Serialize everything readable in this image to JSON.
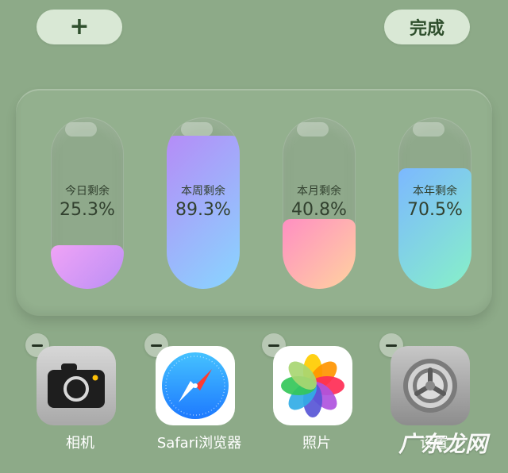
{
  "controls": {
    "add_label": "+",
    "done_label": "完成"
  },
  "widget": {
    "meters": [
      {
        "label": "今日剩余",
        "value": "25.3%",
        "fraction": 0.253
      },
      {
        "label": "本周剩余",
        "value": "89.3%",
        "fraction": 0.893
      },
      {
        "label": "本月剩余",
        "value": "40.8%",
        "fraction": 0.408
      },
      {
        "label": "本年剩余",
        "value": "70.5%",
        "fraction": 0.705
      }
    ]
  },
  "apps": [
    {
      "name": "相机",
      "icon": "camera-icon"
    },
    {
      "name": "Safari浏览器",
      "icon": "safari-icon"
    },
    {
      "name": "照片",
      "icon": "photos-icon"
    },
    {
      "name": "设置",
      "icon": "settings-icon"
    }
  ],
  "watermark": {
    "text": "广东龙网"
  },
  "colors": {
    "background": "#8daa88",
    "button": "#d9e8d5",
    "meter_day_gradient": [
      "#f0a3f6",
      "#bb8ff5"
    ],
    "meter_week_gradient": [
      "#b58cf7",
      "#88d6ff"
    ],
    "meter_month_gradient": [
      "#ff8fc2",
      "#ffd39f"
    ],
    "meter_year_gradient": [
      "#7cb8ff",
      "#87f1c8"
    ]
  }
}
